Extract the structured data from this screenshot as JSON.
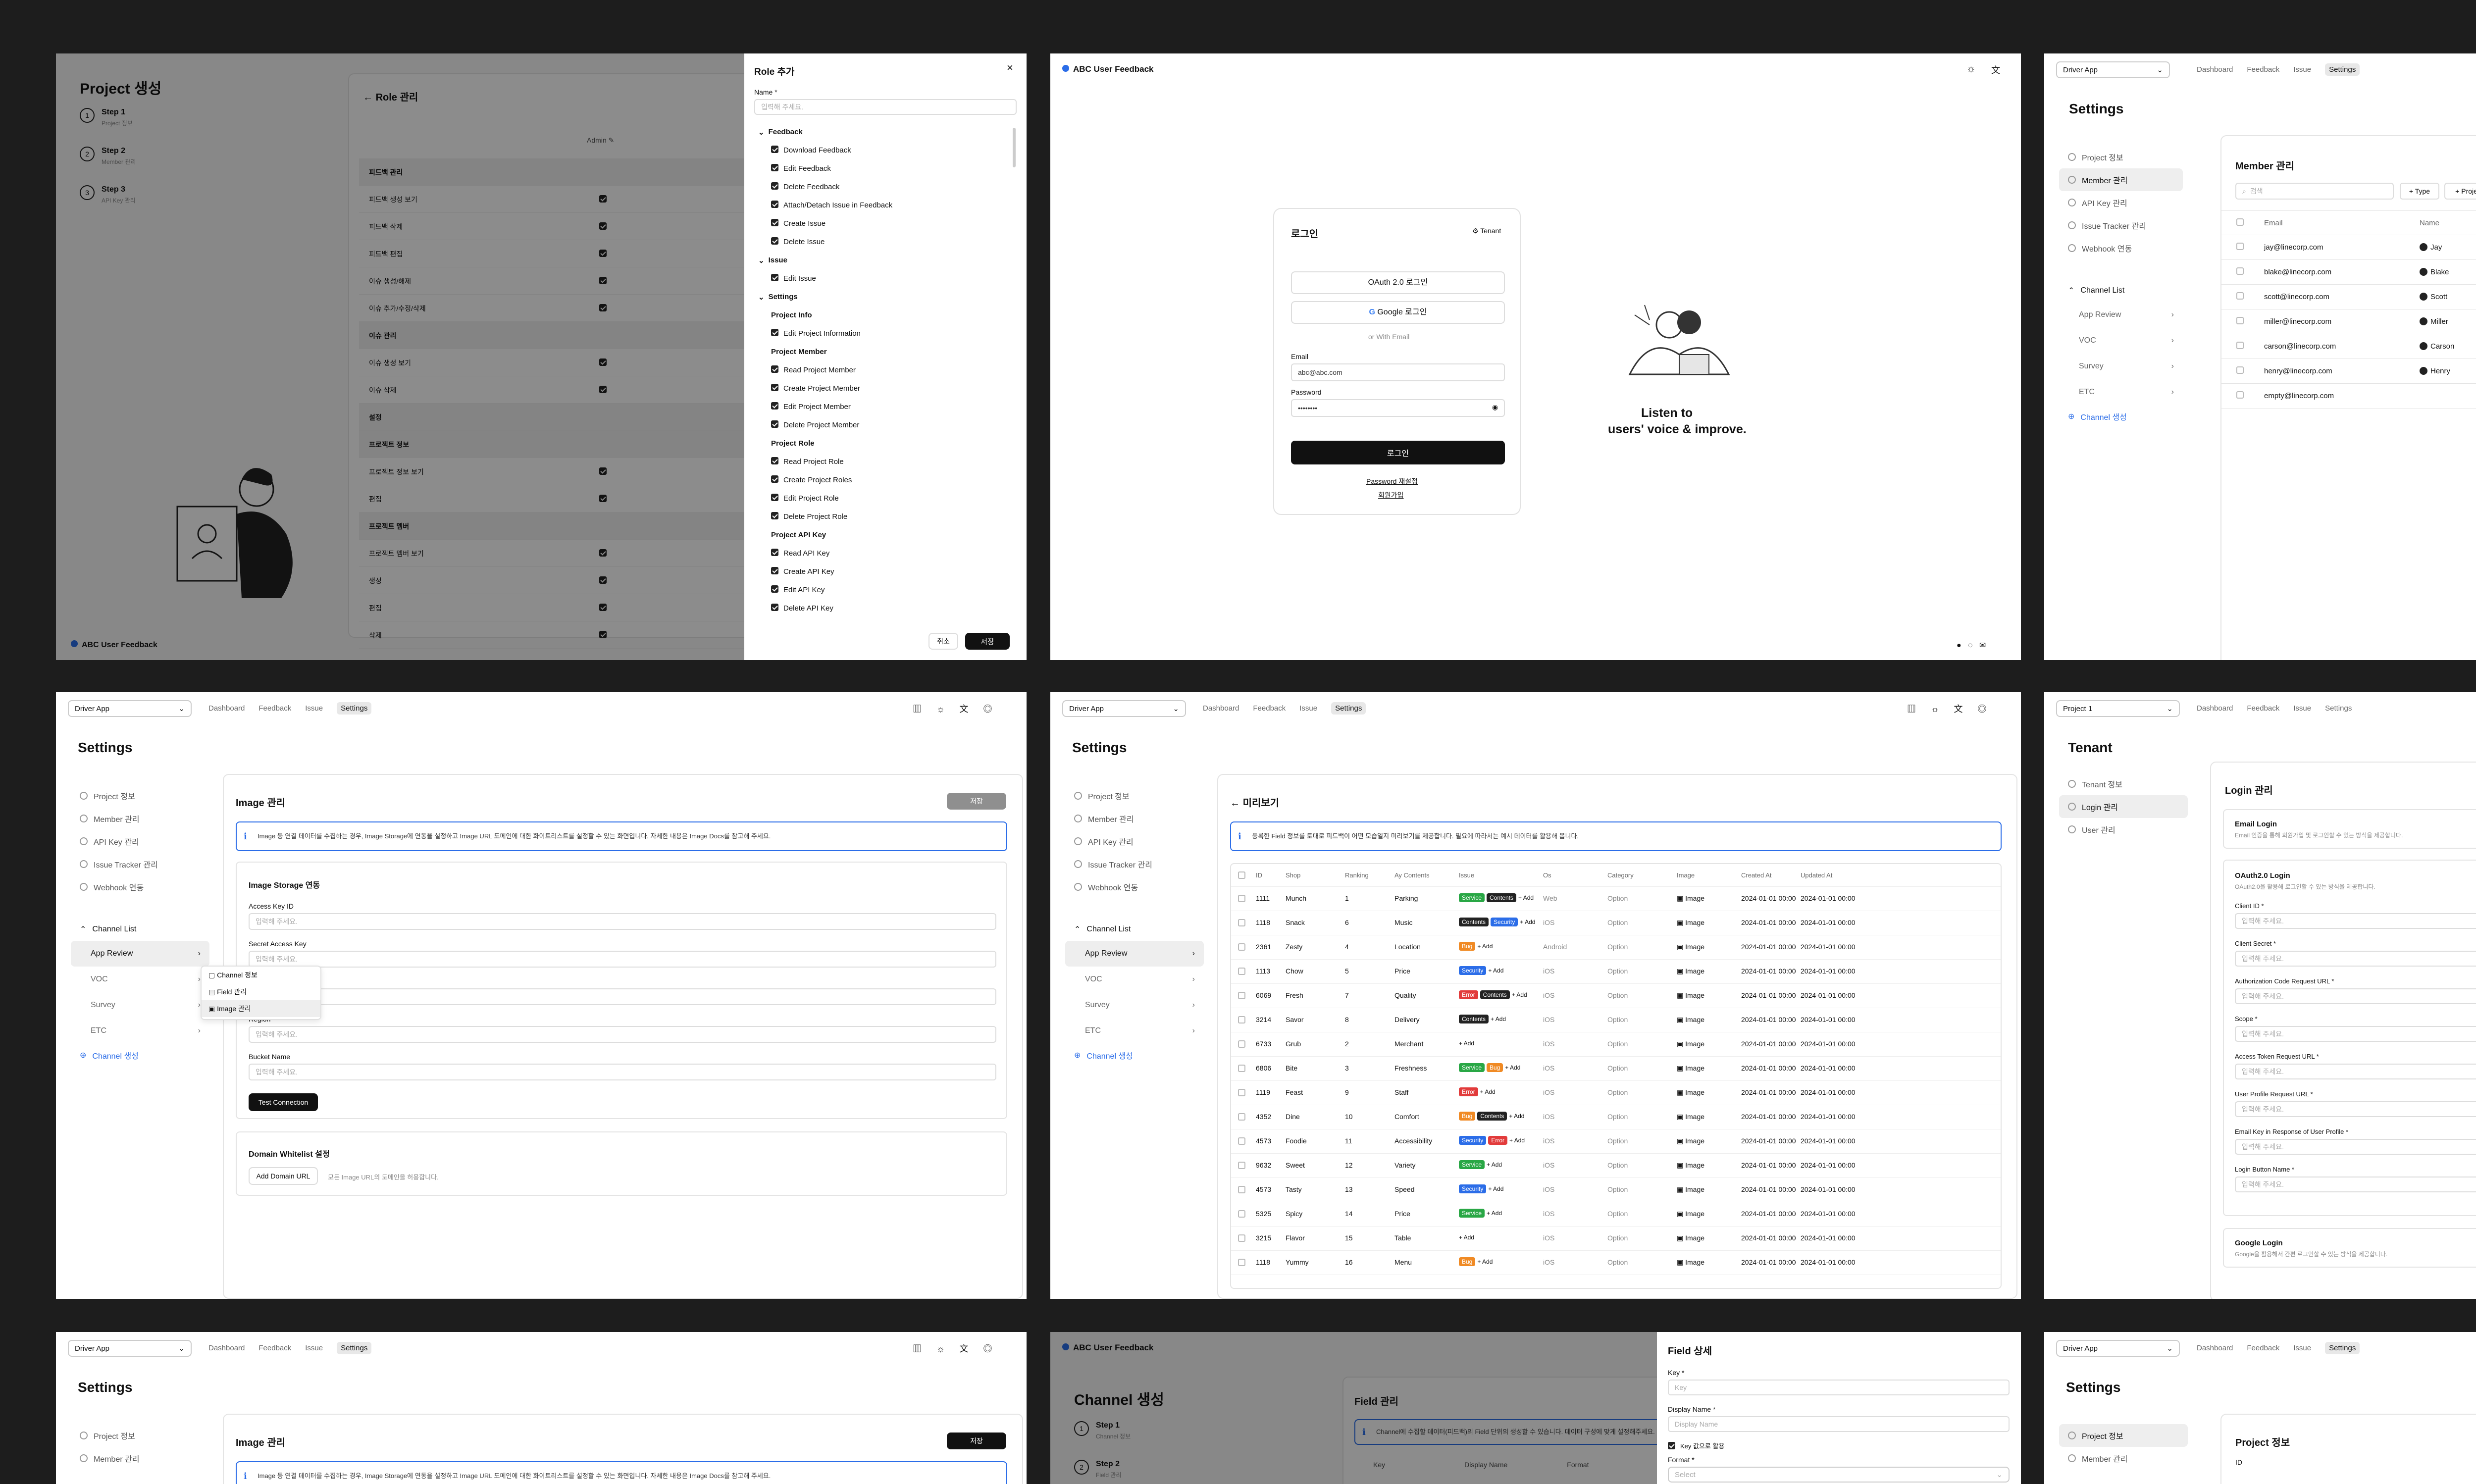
{
  "app_brand": "ABC User Feedback",
  "p1": {
    "title": "Project 생성",
    "steps": [
      {
        "n": "1",
        "title": "Step 1",
        "sub": "Project 정보"
      },
      {
        "n": "2",
        "title": "Step 2",
        "sub": "Member 관리"
      },
      {
        "n": "3",
        "title": "Step 3",
        "sub": "API Key 관리"
      }
    ],
    "back": "Role 관리",
    "col_head": "Admin",
    "rows": [
      "피드백 관리",
      "피드백 생성 보기",
      "피드백 삭제",
      "피드백 편집",
      "이슈 생성/해제",
      "이슈 추가/수정/삭제",
      "이슈 관리",
      "이슈 생성 보기",
      "이슈 삭제",
      "설정",
      "프로젝트 정보",
      "프로젝트 정보 보기",
      "편집",
      "프로젝트 멤버",
      "프로젝트 멤버 보기",
      "생성",
      "편집",
      "삭제"
    ],
    "brand": "ABC User Feedback",
    "modal": {
      "title": "Role 추가",
      "name_label": "Name *",
      "name_placeholder": "입력해 주세요.",
      "items": [
        {
          "t": "g",
          "l": "Feedback"
        },
        {
          "t": "i",
          "l": "Download Feedback"
        },
        {
          "t": "i",
          "l": "Edit Feedback"
        },
        {
          "t": "i",
          "l": "Delete Feedback"
        },
        {
          "t": "i",
          "l": "Attach/Detach Issue in Feedback"
        },
        {
          "t": "i",
          "l": "Create Issue"
        },
        {
          "t": "i",
          "l": "Delete Issue"
        },
        {
          "t": "g",
          "l": "Issue"
        },
        {
          "t": "i",
          "l": "Edit Issue"
        },
        {
          "t": "g",
          "l": "Settings"
        },
        {
          "t": "h",
          "l": "Project Info"
        },
        {
          "t": "i",
          "l": "Edit Project Information"
        },
        {
          "t": "h",
          "l": "Project Member"
        },
        {
          "t": "i",
          "l": "Read Project Member"
        },
        {
          "t": "i",
          "l": "Create Project Member"
        },
        {
          "t": "i",
          "l": "Edit Project Member"
        },
        {
          "t": "i",
          "l": "Delete Project Member"
        },
        {
          "t": "h",
          "l": "Project Role"
        },
        {
          "t": "i",
          "l": "Read Project Role"
        },
        {
          "t": "i",
          "l": "Create Project Roles"
        },
        {
          "t": "i",
          "l": "Edit Project Role"
        },
        {
          "t": "i",
          "l": "Delete Project Role"
        },
        {
          "t": "h",
          "l": "Project API Key"
        },
        {
          "t": "i",
          "l": "Read API Key"
        },
        {
          "t": "i",
          "l": "Create API Key"
        },
        {
          "t": "i",
          "l": "Edit API Key"
        },
        {
          "t": "i",
          "l": "Delete API Key"
        }
      ],
      "cancel": "취소",
      "save": "저장"
    }
  },
  "p2": {
    "login_title": "로그인",
    "tenant": "Tenant",
    "oauth": "OAuth 2.0 로그인",
    "google": "Google 로그인",
    "or": "or With Email",
    "email_label": "Email",
    "email_value": "abc@abc.com",
    "password_label": "Password",
    "password_value": "••••••••",
    "login_btn": "로그인",
    "reset": "Password 재설정",
    "signup": "회원가입",
    "slogan1": "Listen to",
    "slogan2": "users' voice & improve."
  },
  "nav": {
    "project_select": "Driver App",
    "tabs": [
      "Dashboard",
      "Feedback",
      "Issue",
      "Settings"
    ],
    "settings_title": "Settings",
    "side_items": [
      "Project 정보",
      "Member 관리",
      "API Key 관리",
      "Issue Tracker 관리",
      "Webhook 연동"
    ],
    "channel_list": "Channel List",
    "channels": [
      "App Review",
      "VOC",
      "Survey",
      "ETC"
    ],
    "channel_create": "Channel 생성"
  },
  "p3": {
    "card_title": "Member 관리",
    "search": "검색",
    "type_btn": "+ Type",
    "project_btn": "+ Project",
    "col_email": "Email",
    "col_name": "Name",
    "members": [
      {
        "email": "jay@linecorp.com",
        "name": "Jay"
      },
      {
        "email": "blake@linecorp.com",
        "name": "Blake"
      },
      {
        "email": "scott@linecorp.com",
        "name": "Scott"
      },
      {
        "email": "miller@linecorp.com",
        "name": "Miller"
      },
      {
        "email": "carson@linecorp.com",
        "name": "Carson"
      },
      {
        "email": "henry@linecorp.com",
        "name": "Henry"
      },
      {
        "email": "empty@linecorp.com",
        "name": ""
      }
    ]
  },
  "p4": {
    "card_title": "Image 관리",
    "save": "저장",
    "info": "Image 등 연결 데이터를 수집하는 경우, Image Storage에 연동을 설정하고 Image URL 도메인에 대한 화이트리스트를 설정할 수 있는 화면입니다. 자세한 내용은 Image Docs를 참고해 주세요.",
    "storage_title": "Image Storage 연동",
    "fields": [
      "Access Key ID",
      "Secret Access Key",
      "Endpoint",
      "Region",
      "Bucket Name"
    ],
    "placeholder": "입력해 주세요.",
    "test_btn": "Test Connection",
    "whitelist_title": "Domain Whitelist 설정",
    "add_domain": "Add Domain URL",
    "whitelist_hint": "모든 Image URL의 도메인을 허용합니다.",
    "menu": [
      "Channel 정보",
      "Field 관리",
      "Image 관리"
    ]
  },
  "p5": {
    "back": "미리보기",
    "info": "등록한 Field 정보를 토대로 피드백이 어떤 모습일지 미리보기를 제공합니다. 필요에 따라서는 예시 데이터를 활용해 봅니다.",
    "headers": [
      "ID",
      "Shop",
      "Ranking",
      "Ay Contents",
      "Issue",
      "Os",
      "Category",
      "Image",
      "Created At",
      "Updated At"
    ],
    "rows": [
      {
        "id": "1111",
        "shop": "Munch",
        "rank": "1",
        "ct": "Parking",
        "tags": [
          "Service",
          "Contents"
        ],
        "os": "Web",
        "cat": "Option"
      },
      {
        "id": "1118",
        "shop": "Snack",
        "rank": "6",
        "ct": "Music",
        "tags": [
          "Contents",
          "Security"
        ],
        "os": "iOS",
        "cat": "Option"
      },
      {
        "id": "2361",
        "shop": "Zesty",
        "rank": "4",
        "ct": "Location",
        "tags": [
          "Bug"
        ],
        "os": "Android",
        "cat": "Option"
      },
      {
        "id": "1113",
        "shop": "Chow",
        "rank": "5",
        "ct": "Price",
        "tags": [
          "Security"
        ],
        "os": "iOS",
        "cat": "Option"
      },
      {
        "id": "6069",
        "shop": "Fresh",
        "rank": "7",
        "ct": "Quality",
        "tags": [
          "Error",
          "Contents"
        ],
        "os": "iOS",
        "cat": "Option"
      },
      {
        "id": "3214",
        "shop": "Savor",
        "rank": "8",
        "ct": "Delivery",
        "tags": [
          "Contents"
        ],
        "os": "iOS",
        "cat": "Option"
      },
      {
        "id": "6733",
        "shop": "Grub",
        "rank": "2",
        "ct": "Merchant",
        "tags": [],
        "os": "iOS",
        "cat": "Option"
      },
      {
        "id": "6806",
        "shop": "Bite",
        "rank": "3",
        "ct": "Freshness",
        "tags": [
          "Service",
          "Bug"
        ],
        "os": "iOS",
        "cat": "Option"
      },
      {
        "id": "1119",
        "shop": "Feast",
        "rank": "9",
        "ct": "Staff",
        "tags": [
          "Error"
        ],
        "os": "iOS",
        "cat": "Option"
      },
      {
        "id": "4352",
        "shop": "Dine",
        "rank": "10",
        "ct": "Comfort",
        "tags": [
          "Bug",
          "Contents"
        ],
        "os": "iOS",
        "cat": "Option"
      },
      {
        "id": "4573",
        "shop": "Foodie",
        "rank": "11",
        "ct": "Accessibility",
        "tags": [
          "Security",
          "Error"
        ],
        "os": "iOS",
        "cat": "Option"
      },
      {
        "id": "9632",
        "shop": "Sweet",
        "rank": "12",
        "ct": "Variety",
        "tags": [
          "Service"
        ],
        "os": "iOS",
        "cat": "Option"
      },
      {
        "id": "4573",
        "shop": "Tasty",
        "rank": "13",
        "ct": "Speed",
        "tags": [
          "Security"
        ],
        "os": "iOS",
        "cat": "Option"
      },
      {
        "id": "5325",
        "shop": "Spicy",
        "rank": "14",
        "ct": "Price",
        "tags": [
          "Service"
        ],
        "os": "iOS",
        "cat": "Option"
      },
      {
        "id": "3215",
        "shop": "Flavor",
        "rank": "15",
        "ct": "Table",
        "tags": [],
        "os": "iOS",
        "cat": "Option"
      },
      {
        "id": "1118",
        "shop": "Yummy",
        "rank": "16",
        "ct": "Menu",
        "tags": [
          "Bug"
        ],
        "os": "iOS",
        "cat": "Option"
      }
    ],
    "add": "+ Add",
    "image": "Image",
    "date": "2024-01-01 00:00"
  },
  "p6": {
    "project_select": "Project 1",
    "tabs": [
      "Dashboard",
      "Feedback",
      "Issue",
      "Settings"
    ],
    "title": "Tenant",
    "side": [
      "Tenant 정보",
      "Login 관리",
      "User 관리"
    ],
    "card_title": "Login 관리",
    "email_login": "Email Login",
    "email_desc": "Email 인증을 통해 회원가입 및 로그인할 수 있는 방식을 제공합니다.",
    "oauth_title": "OAuth2.0 Login",
    "oauth_desc": "OAuth2.0을 활용해 로그인할 수 있는 방식을 제공합니다.",
    "fields": [
      "Client ID *",
      "Client Secret *",
      "Authorization Code Request URL *",
      "Scope *",
      "Access Token Request URL *",
      "User Profile Request URL *",
      "Email Key in Response of User Profile *",
      "Login Button Name *"
    ],
    "placeholder": "입력해 주세요.",
    "google_title": "Google Login",
    "google_desc": "Google을 활용해서 간편 로그인할 수 있는 방식을 제공합니다."
  },
  "p8": {
    "title": "Channel 생성",
    "steps": [
      {
        "n": "1",
        "title": "Step 1",
        "sub": "Channel 정보"
      },
      {
        "n": "2",
        "title": "Step 2",
        "sub": "Field 관리"
      }
    ],
    "card_title": "Field 관리",
    "info": "Channel에 수집할 데이터(피드백)의 Field 단위의 생성할 수 있습니다. 데이터 구성에 맞게 설정해주세요.",
    "cols": [
      "Key",
      "Display Name",
      "Format"
    ],
    "drawer_title": "Field 상세",
    "key_label": "Key *",
    "key_ph": "Key",
    "dn_label": "Display Name *",
    "dn_ph": "Display Name",
    "check_label": "Key 값으로 활용",
    "format_label": "Format *",
    "format_ph": "Select"
  },
  "p9": {
    "card_title": "Project 정보",
    "id_label": "ID"
  }
}
